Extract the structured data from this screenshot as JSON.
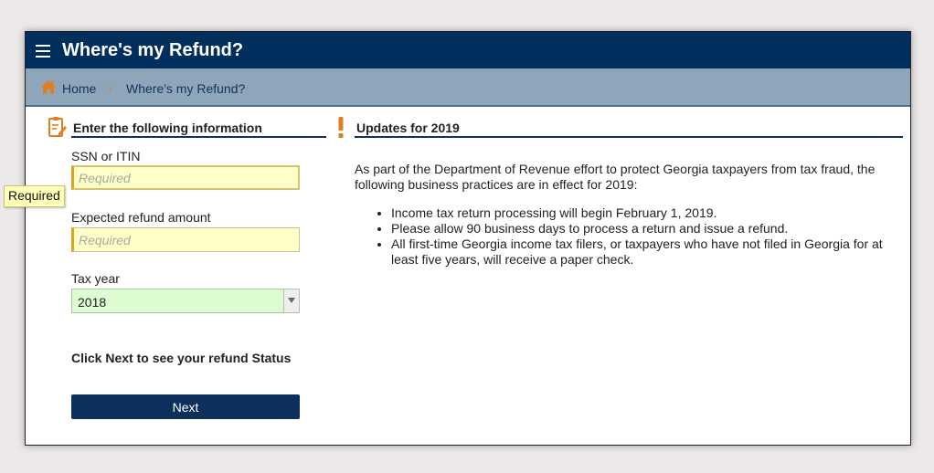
{
  "header": {
    "title": "Where's my Refund?"
  },
  "breadcrumb": {
    "home": "Home",
    "separator": "›",
    "current": "Where's my Refund?"
  },
  "form": {
    "heading": "Enter the following information",
    "ssn": {
      "label": "SSN or ITIN",
      "placeholder": "Required",
      "value": ""
    },
    "tooltip": "Required",
    "amount": {
      "label": "Expected refund amount",
      "placeholder": "Required",
      "value": ""
    },
    "tax_year": {
      "label": "Tax year",
      "value": "2018"
    },
    "instruction": "Click Next to see your refund Status",
    "next_label": "Next"
  },
  "updates": {
    "heading": "Updates for 2019",
    "intro": "As part of the Department of Revenue effort to protect Georgia taxpayers from tax fraud, the following business practices are in effect for 2019:",
    "items": [
      "Income tax return processing will begin February 1, 2019.",
      "Please allow 90 business days to process a return and issue a refund.",
      "All first-time Georgia income tax filers, or taxpayers who have not filed in Georgia for at least five years, will receive a paper check."
    ]
  },
  "colors": {
    "header": "#002e5d",
    "breadcrumb": "#8fa5b9",
    "accent": "#e07f22",
    "required_field": "#ffffc8",
    "valid_field": "#ddfcd1",
    "button": "#0c2f5b"
  }
}
